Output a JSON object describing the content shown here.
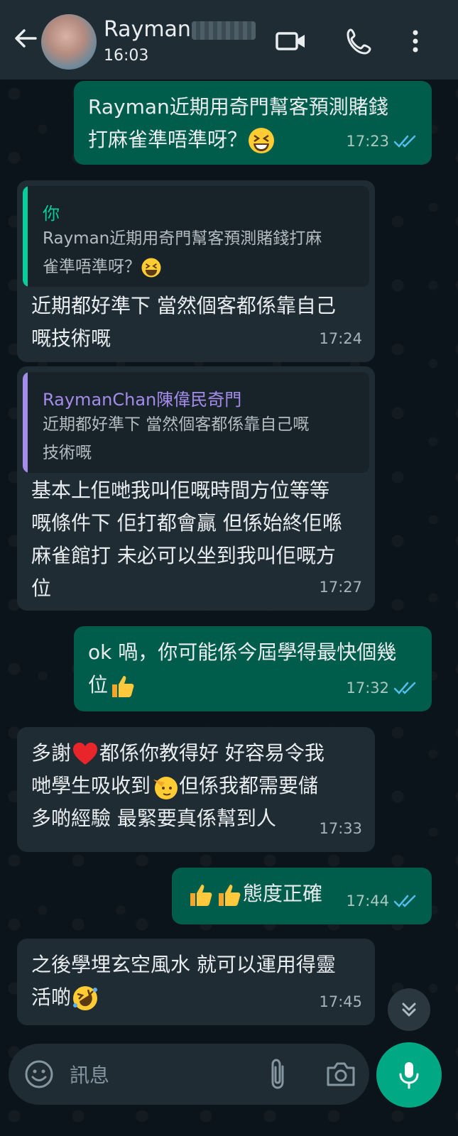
{
  "header": {
    "contact_name": "Rayman",
    "last_seen": "16:03"
  },
  "messages": [
    {
      "direction": "out",
      "text_line1": "Rayman近期用奇門幫客預測賭錢",
      "text_line2": "打麻雀準唔準呀？",
      "emoji": "grinning-squinting-face",
      "time": "17:23",
      "status": "read"
    },
    {
      "direction": "in",
      "quote_author": "你",
      "quote_line1": "Rayman近期用奇門幫客預測賭錢打麻",
      "quote_line2": "雀準唔準呀？",
      "text_line1": "近期都好準下 當然個客都係靠自己",
      "text_line2": "嘅技術嘅",
      "time": "17:24"
    },
    {
      "direction": "in",
      "quote_author": "RaymanChan陳偉民奇門",
      "quote_line1": "近期都好準下 當然個客都係靠自己嘅",
      "quote_line2": "技術嘅",
      "text_line1": "基本上佢哋我叫佢嘅時間方位等等",
      "text_line2": "嘅條件下 佢打都會贏 但係始終佢喺",
      "text_line3": "麻雀館打 未必可以坐到我叫佢嘅方",
      "text_line4": "位",
      "time": "17:27"
    },
    {
      "direction": "out",
      "text_line1": "ok 喎，你可能係今屆學得最快個幾",
      "text_line2": "位",
      "emoji": "thumbs-up",
      "time": "17:32",
      "status": "read"
    },
    {
      "direction": "in",
      "text_line1a": "多謝",
      "text_line1b": "都係你教得好 好容易令我",
      "text_line2a": "哋學生吸收到",
      "text_line2b": "但係我都需要儲",
      "text_line3": "多啲經驗 最緊要真係幫到人",
      "time": "17:33"
    },
    {
      "direction": "out",
      "text": "態度正確",
      "time": "17:44",
      "status": "read"
    },
    {
      "direction": "in",
      "text_line1": "之後學埋玄空風水 就可以運用得靈",
      "text_line2": "活啲",
      "time": "17:45"
    }
  ],
  "composer": {
    "placeholder": "訊息"
  },
  "colors": {
    "outgoing_bubble": "#005c4b",
    "incoming_bubble": "#1f2c34",
    "accent": "#00a884",
    "read_ticks": "#53bdeb"
  }
}
